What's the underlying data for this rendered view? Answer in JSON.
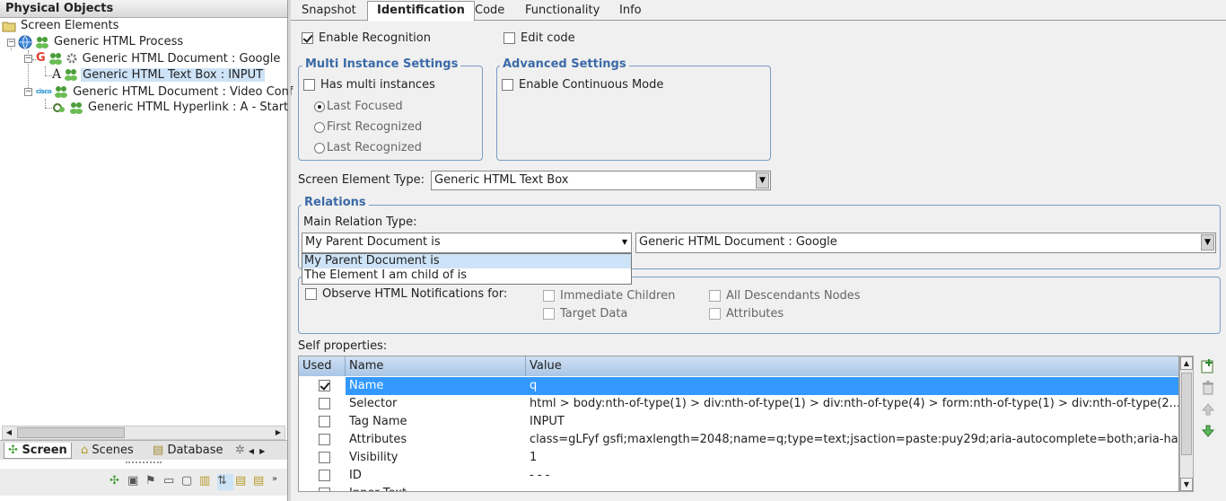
{
  "left_panel": {
    "title": "Physical Objects",
    "tree": [
      {
        "label": "Screen Elements",
        "icon": "folder-icon"
      },
      {
        "label": "Generic HTML Process",
        "icon": "globe-icon"
      },
      {
        "label": "Generic HTML Document : Google",
        "icon": "google-icon"
      },
      {
        "label": "Generic HTML Text Box : INPUT",
        "icon": "textbox-icon",
        "selected": true
      },
      {
        "label": "Generic HTML Document : Video Conf",
        "icon": "cisco-icon"
      },
      {
        "label": "Generic HTML Hyperlink : A - Start",
        "icon": "hyperlink-icon"
      }
    ],
    "bottom_tabs": [
      "Screen",
      "Scenes",
      "Database"
    ]
  },
  "tabs": [
    "Snapshot",
    "Identification",
    "Code",
    "Functionality",
    "Info"
  ],
  "active_tab": "Identification",
  "enable_recognition": {
    "label": "Enable Recognition",
    "checked": true
  },
  "edit_code": {
    "label": "Edit code",
    "checked": false
  },
  "multi_instance": {
    "title": "Multi Instance Settings",
    "has_multi": "Has multi instances",
    "options": [
      "Last Focused",
      "First Recognized",
      "Last Recognized"
    ],
    "selected": "Last Focused"
  },
  "advanced": {
    "title": "Advanced Settings",
    "continuous": "Enable Continuous Mode"
  },
  "screen_element_type": {
    "label": "Screen Element Type:",
    "value": "Generic HTML Text Box"
  },
  "relations": {
    "title": "Relations",
    "main_label": "Main Relation Type:",
    "main_value": "My Parent Document is",
    "target_value": "Generic HTML Document : Google",
    "dropdown_options": [
      "My Parent Document is",
      "The Element I am child of is"
    ]
  },
  "notifications": {
    "observe": "Observe HTML Notifications for:",
    "immediate": "Immediate Children",
    "all_desc": "All Descendants Nodes",
    "target": "Target Data",
    "attributes": "Attributes"
  },
  "self_properties": {
    "label": "Self properties:",
    "columns": [
      "Used",
      "Name",
      "Value"
    ],
    "rows": [
      {
        "used": true,
        "name": "Name",
        "value": "q",
        "selected": true
      },
      {
        "used": false,
        "name": "Selector",
        "value": "html > body:nth-of-type(1) > div:nth-of-type(1) > div:nth-of-type(4) > form:nth-of-type(1) > div:nth-of-type(2..."
      },
      {
        "used": false,
        "name": "Tag Name",
        "value": "INPUT"
      },
      {
        "used": false,
        "name": "Attributes",
        "value": "class=gLFyf gsfi;maxlength=2048;name=q;type=text;jsaction=paste:puy29d;aria-autocomplete=both;aria-hasp..."
      },
      {
        "used": false,
        "name": "Visibility",
        "value": "1"
      },
      {
        "used": false,
        "name": "ID",
        "value": "- - -"
      },
      {
        "used": false,
        "name": "Inner Text",
        "value": ""
      }
    ]
  }
}
